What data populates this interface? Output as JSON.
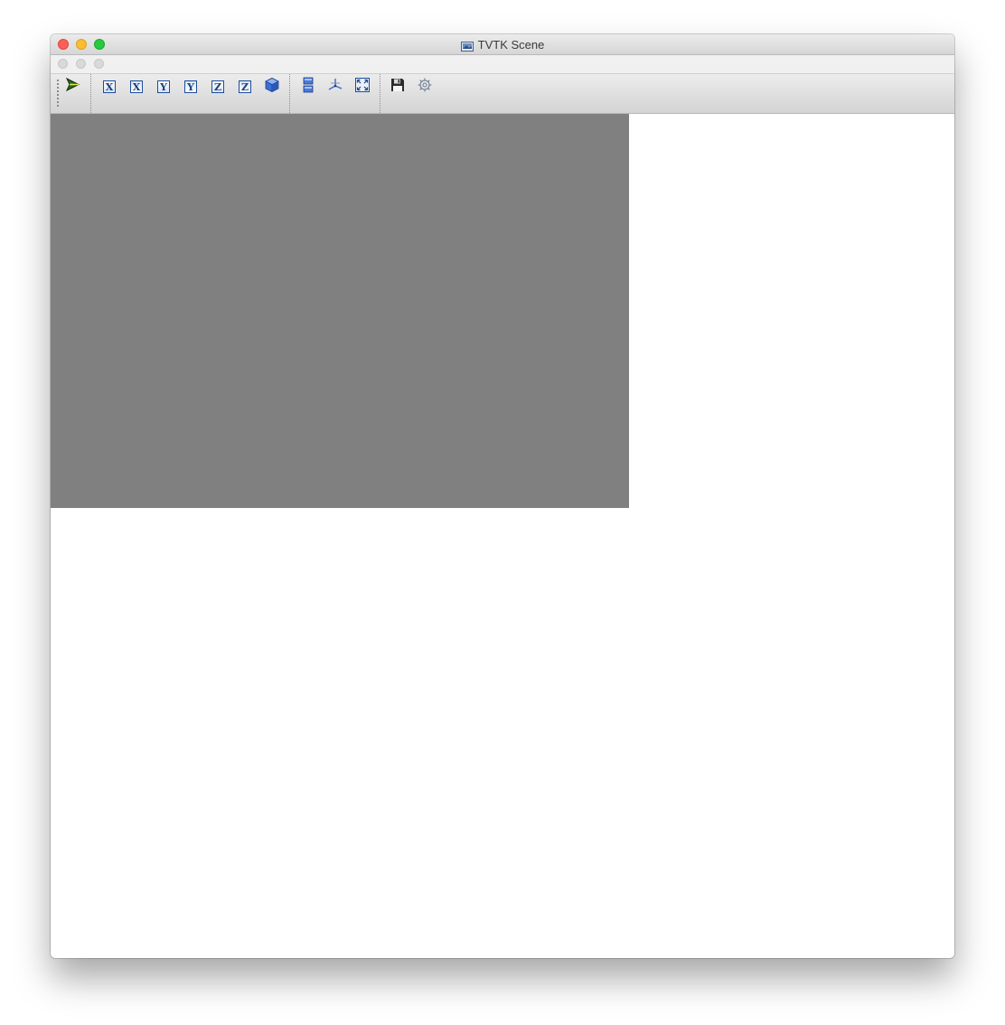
{
  "window": {
    "title": "TVTK Scene"
  },
  "toolbar": {
    "buttons": [
      {
        "name": "interaction-mode",
        "icon": "interaction-arrow-icon"
      },
      {
        "name": "view-x-positive",
        "icon": "x-axis-view-icon",
        "label": "X"
      },
      {
        "name": "view-x-negative",
        "icon": "x-axis-view-icon",
        "label": "X"
      },
      {
        "name": "view-y-positive",
        "icon": "y-axis-view-icon",
        "label": "Y"
      },
      {
        "name": "view-y-negative",
        "icon": "y-axis-view-icon",
        "label": "Y"
      },
      {
        "name": "view-z-positive",
        "icon": "z-axis-view-icon",
        "label": "Z"
      },
      {
        "name": "view-z-negative",
        "icon": "z-axis-view-icon",
        "label": "Z"
      },
      {
        "name": "isometric-view",
        "icon": "isometric-cube-icon"
      },
      {
        "name": "parallel-projection",
        "icon": "projection-toggle-icon"
      },
      {
        "name": "toggle-axes",
        "icon": "axes-indicator-icon"
      },
      {
        "name": "full-screen",
        "icon": "full-screen-icon"
      },
      {
        "name": "save-scene",
        "icon": "save-icon"
      },
      {
        "name": "configure-scene",
        "icon": "gear-icon"
      }
    ]
  },
  "scene": {
    "background_color": "#808080"
  },
  "colors": {
    "close": "#fe5f57",
    "minimize": "#febc2e",
    "maximize": "#28c840",
    "axis_icon_blue": "#1d4e9a"
  }
}
